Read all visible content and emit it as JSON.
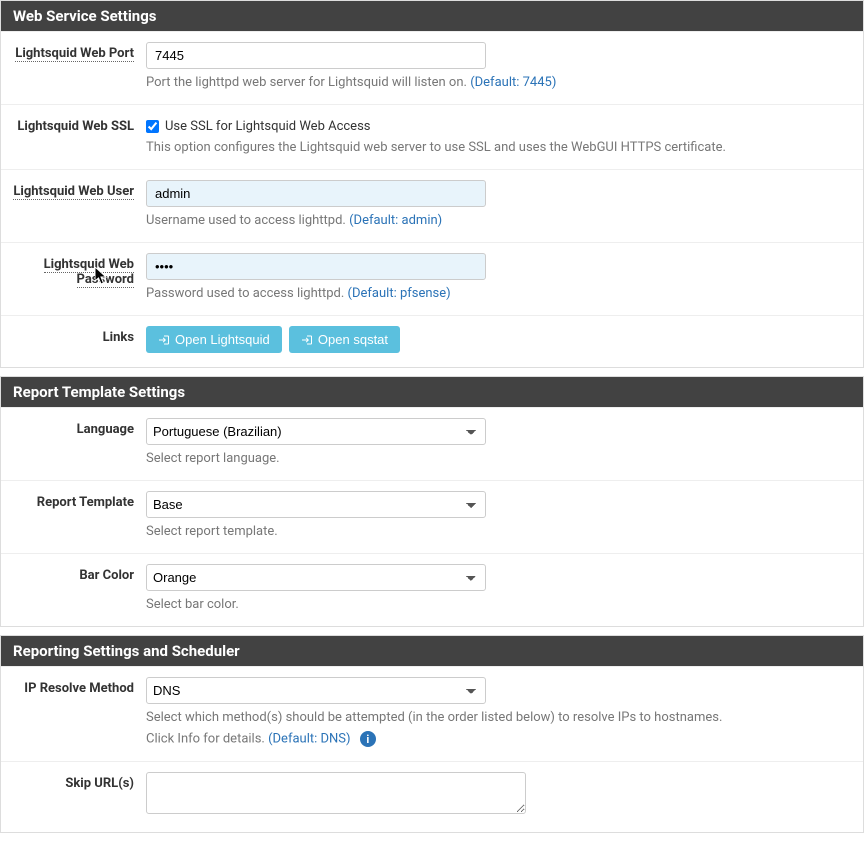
{
  "sections": {
    "web_service": "Web Service Settings",
    "report_template": "Report Template Settings",
    "reporting_scheduler": "Reporting Settings and Scheduler"
  },
  "web": {
    "port_label": "Lightsquid Web Port",
    "port_value": "7445",
    "port_help": "Port the lighttpd web server for Lightsquid will listen on. ",
    "port_default": "(Default: 7445)",
    "ssl_label": "Lightsquid Web SSL",
    "ssl_checkbox_label": "Use SSL for Lightsquid Web Access",
    "ssl_help": "This option configures the Lightsquid web server to use SSL and uses the WebGUI HTTPS certificate.",
    "user_label": "Lightsquid Web User",
    "user_value": "admin",
    "user_help": "Username used to access lighttpd. ",
    "user_default": "(Default: admin)",
    "password_label": "Lightsquid Web Password",
    "password_value": "••••",
    "password_help": "Password used to access lighttpd. ",
    "password_default": "(Default: pfsense)",
    "links_label": "Links",
    "btn_open_lightsquid": "Open Lightsquid",
    "btn_open_sqstat": "Open sqstat"
  },
  "report": {
    "language_label": "Language",
    "language_value": "Portuguese (Brazilian)",
    "language_help": "Select report language.",
    "template_label": "Report Template",
    "template_value": "Base",
    "template_help": "Select report template.",
    "barcolor_label": "Bar Color",
    "barcolor_value": "Orange",
    "barcolor_help": "Select bar color."
  },
  "scheduler": {
    "resolve_label": "IP Resolve Method",
    "resolve_value": "DNS",
    "resolve_help1": "Select which method(s) should be attempted (in the order listed below) to resolve IPs to hostnames.",
    "resolve_help2": "Click Info for details. ",
    "resolve_default": "(Default: DNS)",
    "skip_label": "Skip URL(s)"
  }
}
